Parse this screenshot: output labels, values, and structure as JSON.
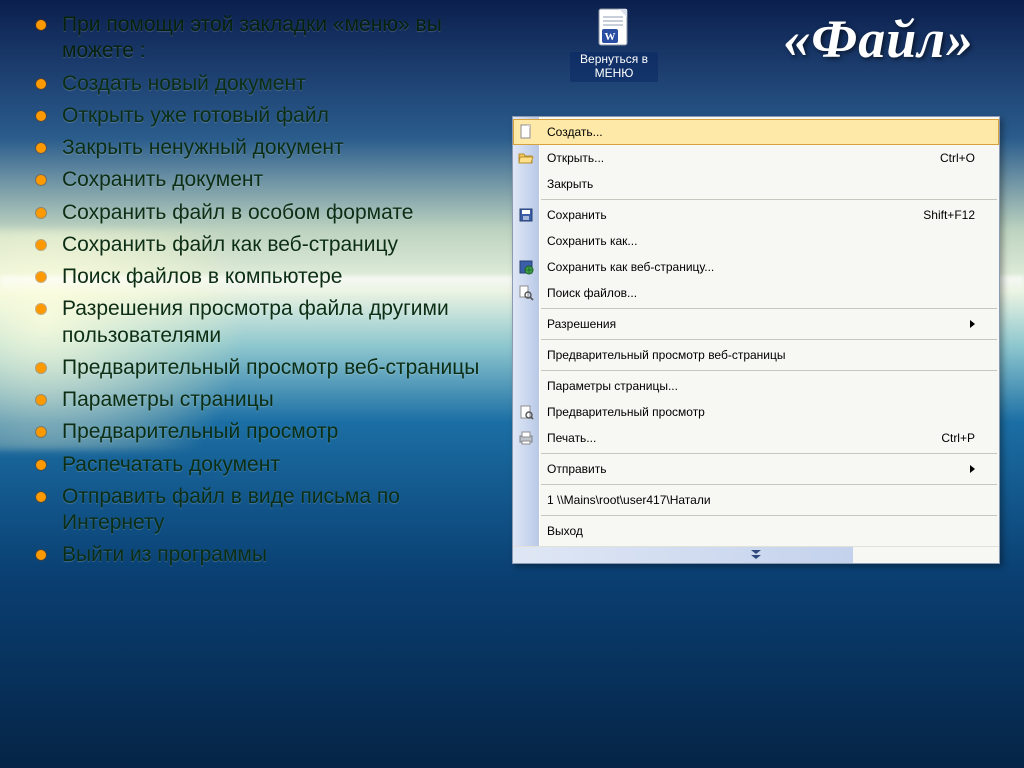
{
  "title": "«Файл»",
  "back_button": {
    "label": "Вернуться в МЕНЮ",
    "icon": "word-document-icon"
  },
  "bullets": [
    "При помощи этой закладки «меню» вы можете :",
    "Создать новый документ",
    "Открыть уже готовый файл",
    "Закрыть ненужный документ",
    "Сохранить документ",
    "Сохранить файл в особом формате",
    "Сохранить файл как веб-страницу",
    "Поиск файлов в компьютере",
    "Разрешения просмотра файла другими пользователями",
    "Предварительный просмотр веб-страницы",
    "Параметры страницы",
    "Предварительный просмотр",
    "Распечатать документ",
    "Отправить файл в виде письма по Интернету",
    "Выйти из программы"
  ],
  "menu": {
    "items": [
      {
        "label": "Создать...",
        "icon": "new-doc-icon",
        "shortcut": "",
        "submenu": false,
        "highlight": true
      },
      {
        "label": "Открыть...",
        "icon": "folder-open-icon",
        "shortcut": "Ctrl+O",
        "submenu": false,
        "highlight": false
      },
      {
        "label": "Закрыть",
        "icon": "",
        "shortcut": "",
        "submenu": false,
        "highlight": false
      },
      {
        "sep": true
      },
      {
        "label": "Сохранить",
        "icon": "save-icon",
        "shortcut": "Shift+F12",
        "submenu": false,
        "highlight": false
      },
      {
        "label": "Сохранить как...",
        "icon": "",
        "shortcut": "",
        "submenu": false,
        "highlight": false
      },
      {
        "label": "Сохранить как веб-страницу...",
        "icon": "save-web-icon",
        "shortcut": "",
        "submenu": false,
        "highlight": false
      },
      {
        "label": "Поиск файлов...",
        "icon": "search-file-icon",
        "shortcut": "",
        "submenu": false,
        "highlight": false
      },
      {
        "sep": true
      },
      {
        "label": "Разрешения",
        "icon": "",
        "shortcut": "",
        "submenu": true,
        "highlight": false
      },
      {
        "sep": true
      },
      {
        "label": "Предварительный просмотр веб-страницы",
        "icon": "",
        "shortcut": "",
        "submenu": false,
        "highlight": false
      },
      {
        "sep": true
      },
      {
        "label": "Параметры страницы...",
        "icon": "",
        "shortcut": "",
        "submenu": false,
        "highlight": false
      },
      {
        "label": "Предварительный просмотр",
        "icon": "print-preview-icon",
        "shortcut": "",
        "submenu": false,
        "highlight": false
      },
      {
        "label": "Печать...",
        "icon": "printer-icon",
        "shortcut": "Ctrl+P",
        "submenu": false,
        "highlight": false
      },
      {
        "sep": true
      },
      {
        "label": "Отправить",
        "icon": "",
        "shortcut": "",
        "submenu": true,
        "highlight": false
      },
      {
        "sep": true
      },
      {
        "label": "1 \\\\Mains\\root\\user417\\Натали",
        "icon": "",
        "shortcut": "",
        "submenu": false,
        "highlight": false
      },
      {
        "sep": true
      },
      {
        "label": "Выход",
        "icon": "",
        "shortcut": "",
        "submenu": false,
        "highlight": false
      }
    ],
    "expand_hint": "expand"
  }
}
